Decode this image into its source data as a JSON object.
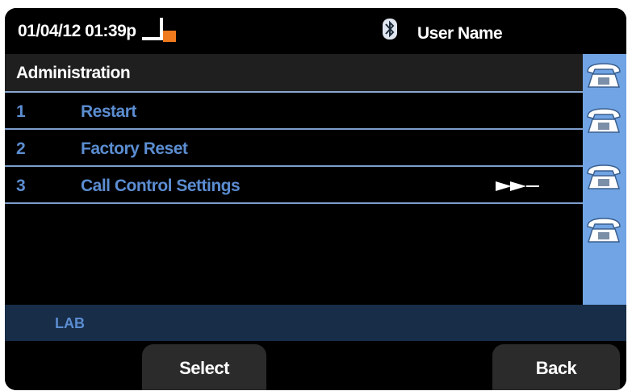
{
  "status": {
    "datetime": "01/04/12 01:39p",
    "user": "User Name",
    "offhook_icon": "offhook-handset-icon",
    "bluetooth_icon": "bluetooth-icon"
  },
  "title": "Administration",
  "menu": [
    {
      "num": "1",
      "label": "Restart"
    },
    {
      "num": "2",
      "label": "Factory Reset"
    },
    {
      "num": "3",
      "label": "Call Control Settings",
      "has_submenu": true
    }
  ],
  "line_keys": [
    "phone-icon",
    "phone-icon",
    "phone-icon",
    "phone-icon"
  ],
  "footer": {
    "label": "LAB"
  },
  "softkeys": {
    "select": "Select",
    "back": "Back"
  },
  "colors": {
    "accent_blue": "#5b8dd1",
    "line_panel": "#70a4e4",
    "footer_bar": "#172d48",
    "offhook_orange": "#f07a1e"
  }
}
